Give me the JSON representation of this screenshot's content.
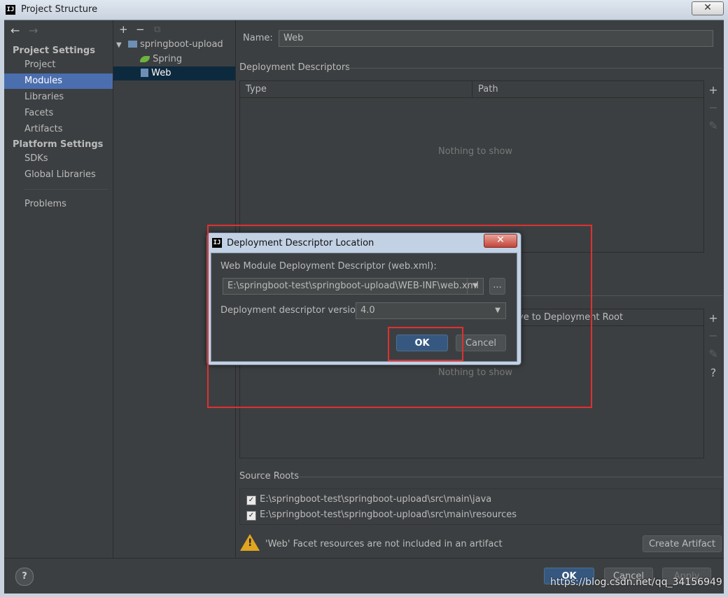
{
  "window": {
    "title": "Project Structure",
    "close": "✕"
  },
  "nav": {
    "back": "←",
    "forward": "→"
  },
  "sidebar": {
    "project_settings": "Project Settings",
    "project_items": [
      "Project",
      "Modules",
      "Libraries",
      "Facets",
      "Artifacts"
    ],
    "platform_settings": "Platform Settings",
    "platform_items": [
      "SDKs",
      "Global Libraries"
    ],
    "problems": "Problems",
    "selected": "Modules"
  },
  "tree": {
    "toolbar": {
      "add": "+",
      "remove": "−",
      "copy": "⧉"
    },
    "root": "springboot-upload",
    "children": [
      "Spring",
      "Web"
    ],
    "selected": "Web"
  },
  "main": {
    "name_label": "Name:",
    "name_value": "Web",
    "deployment_descriptors": "Deployment Descriptors",
    "dd_columns": [
      "Type",
      "Path"
    ],
    "nothing_to_show": "Nothing to show",
    "web_resource_col_partial": "ve to Deployment Root",
    "source_roots": "Source Roots",
    "source_paths": [
      "E:\\springboot-test\\springboot-upload\\src\\main\\java",
      "E:\\springboot-test\\springboot-upload\\src\\main\\resources"
    ],
    "warning": "'Web' Facet resources are not included in an artifact",
    "create_artifact": "Create Artifact",
    "toolbar": {
      "add": "+",
      "remove": "−",
      "edit": "✎",
      "help": "?"
    }
  },
  "footer": {
    "help": "?",
    "ok": "OK",
    "cancel": "Cancel",
    "apply": "Apply"
  },
  "dialog": {
    "title": "Deployment Descriptor Location",
    "close": "✕",
    "descriptor_label": "Web Module Deployment Descriptor (web.xml):",
    "descriptor_path": "E:\\springboot-test\\springboot-upload\\WEB-INF\\web.xml",
    "browse": "...",
    "version_label": "Deployment descriptor version",
    "version_value": "4.0",
    "ok": "OK",
    "cancel": "Cancel"
  },
  "watermark": "https://blog.csdn.net/qq_34156949",
  "colors": {
    "selection": "#4b6eaf",
    "highlight_box": "#e03030",
    "background": "#3c3f41"
  }
}
